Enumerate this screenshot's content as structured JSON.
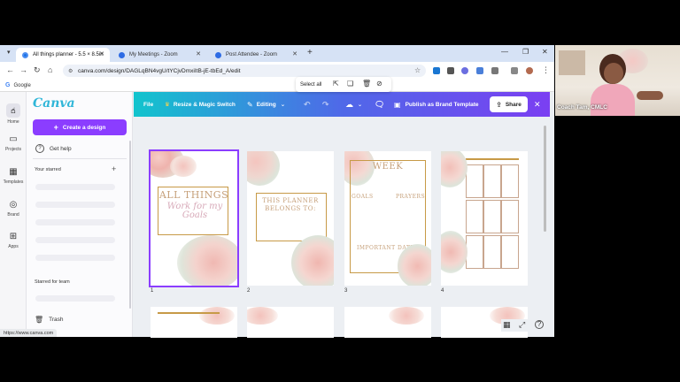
{
  "browser": {
    "tabs": [
      {
        "label": "All things planner - 5.5 × 8.5in",
        "active": true
      },
      {
        "label": "My Meetings - Zoom",
        "active": false
      },
      {
        "label": "Post Attendee - Zoom",
        "active": false
      }
    ],
    "url": "canva.com/design/DAGLqBN4vgU/tYCjvDmxiItB-jE-tbEd_A/edit",
    "bookmarks": [
      {
        "label": "Google"
      }
    ],
    "status_url": "https://www.canva.com"
  },
  "canva": {
    "logo": "Canva",
    "rail": [
      {
        "label": "Home",
        "icon": "home-icon"
      },
      {
        "label": "Projects",
        "icon": "folder-icon"
      },
      {
        "label": "Templates",
        "icon": "templates-icon"
      },
      {
        "label": "Brand",
        "icon": "brand-icon"
      },
      {
        "label": "Apps",
        "icon": "apps-icon"
      }
    ],
    "panel": {
      "create_label": "Create a design",
      "help_label": "Get help",
      "starred_label": "Your starred",
      "team_label": "Starred for team",
      "trash_label": "Trash"
    },
    "editor_bar": {
      "file_label": "File",
      "resize_label": "Resize & Magic Switch",
      "editing_label": "Editing",
      "publish_label": "Publish as Brand Template",
      "share_label": "Share"
    },
    "page_toolbar": {
      "select_all_label": "Select all"
    },
    "pages": [
      {
        "number": "1",
        "lines": [
          "ALL THINGS"
        ],
        "script": "Work  for my  Goals"
      },
      {
        "number": "2",
        "lines": [
          "THIS PLANNER",
          "BELONGS TO:"
        ]
      },
      {
        "number": "3",
        "lines": [
          "WEEK"
        ],
        "goals": "GOALS",
        "prayers": "PRAYERS",
        "dates": "IMPORTANT DATES"
      },
      {
        "number": "4",
        "lines": []
      }
    ]
  },
  "zoom": {
    "participant_name": "Coach Tam, CMLC"
  },
  "colors": {
    "canva_purple": "#8b3dff",
    "canva_teal": "#12c4cd",
    "gold": "#c79a47",
    "blush": "#f2c7c3"
  }
}
